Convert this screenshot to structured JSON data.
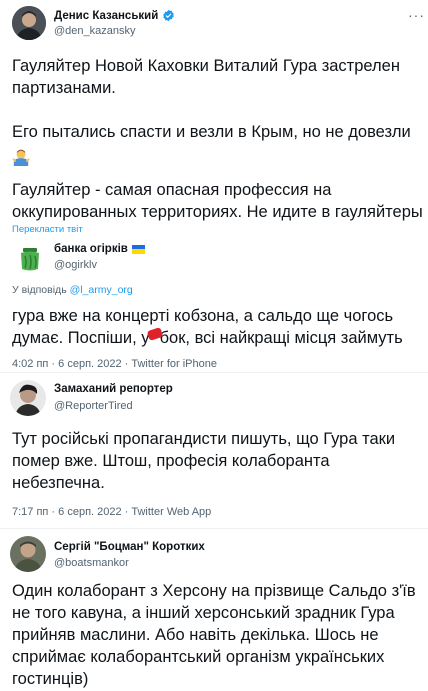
{
  "tweet1": {
    "author_name": "Денис Казанський",
    "author_handle": "@den_kazansky",
    "lines": [
      "Гауляйтер Новой Каховки Виталий Гура застрелен",
      "партизанами.",
      "",
      "Его пытались спасти и везли в Крым, но не довезли",
      "",
      "Гауляйтер - самая опасная профессия на",
      "оккупированных территориях. Не идите в гауляйтеры"
    ],
    "translate_label": "Перекласти твіт",
    "emoji_icon": "man-shrugging-emoji"
  },
  "reply1": {
    "author_name": "банка огірків",
    "author_handle": "@ogirklv",
    "reply_to_prefix": "У відповідь ",
    "reply_to_handle": "@l_army_org",
    "lines": [
      "гура вже на концерті кобзона, а сальдо ще чогось",
      "думає. Поспіши, у",
      "бок, всі найкращі місця займуть"
    ],
    "timestamp": "4:02 пп · 6 серп. 2022 · Twitter for iPhone",
    "flag_colors": [
      "#1a6ee0",
      "#ffd800"
    ]
  },
  "reply2": {
    "author_name": "Замаханий репортер",
    "author_handle": "@ReporterTired",
    "lines": [
      "Тут російські пропагандисти пишуть, що Гура таки",
      "помер вже. Штош, професія колаборанта",
      "небезпечна."
    ],
    "timestamp": "7:17 пп · 6 серп. 2022 · Twitter Web App"
  },
  "reply3": {
    "author_name": "Сергій \"Боцман\" Коротких",
    "author_handle": "@boatsmankor",
    "lines": [
      "Один колаборант з Херсону на прізвище Сальдо з'їв",
      "не того кавуна, а інший херсонський зрадник Гура",
      "прийняв маслини. Або навіть декілька. Шось не",
      "сприймає колаборантський організм українських",
      "гостинців)"
    ]
  },
  "colors": {
    "link": "#1d9bf0",
    "secondary_text": "#536471",
    "primary_text": "#0f1419",
    "verified": "#1d9bf0"
  },
  "more_icon": "more-options-icon"
}
